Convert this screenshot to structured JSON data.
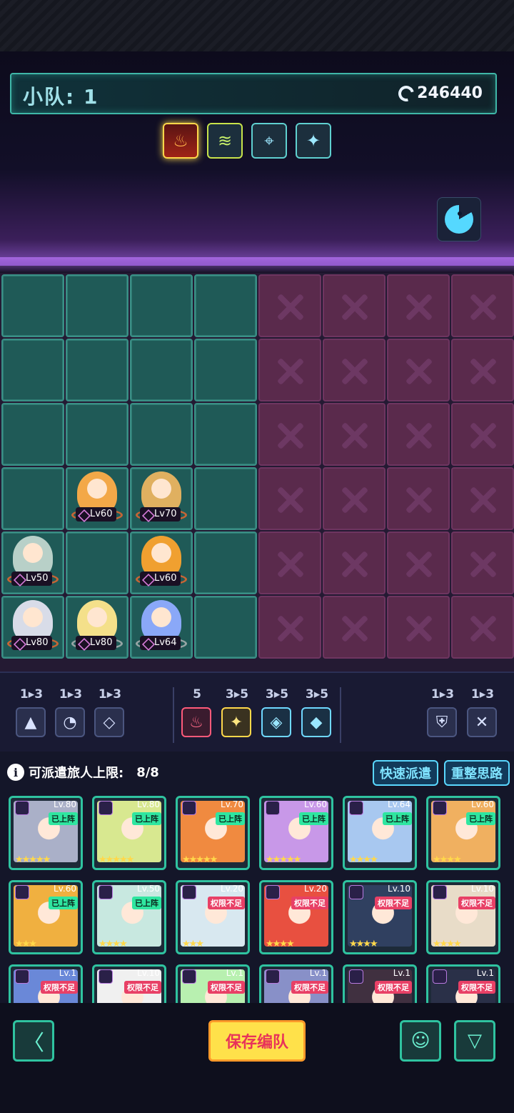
{
  "header": {
    "squad_label": "小队: 1",
    "power": "246440"
  },
  "bonds": [
    {
      "icon": "flame-icon",
      "glyph": "♨"
    },
    {
      "icon": "wave-icon",
      "glyph": "≋"
    },
    {
      "icon": "target-icon",
      "glyph": "⌖"
    },
    {
      "icon": "sparkle-wand-icon",
      "glyph": "✦"
    }
  ],
  "units": [
    {
      "lv": "Lv60"
    },
    {
      "lv": "Lv70"
    },
    {
      "lv": "Lv50"
    },
    {
      "lv": "Lv60"
    },
    {
      "lv": "Lv80"
    },
    {
      "lv": "Lv80"
    },
    {
      "lv": "Lv64"
    }
  ],
  "synergies": {
    "left": [
      {
        "count": "1▸3",
        "glyph": "▲"
      },
      {
        "count": "1▸3",
        "glyph": "◔"
      },
      {
        "count": "1▸3",
        "glyph": "◇"
      }
    ],
    "center": [
      {
        "count": "5",
        "glyph": "♨"
      },
      {
        "count": "3▸5",
        "glyph": "✦"
      },
      {
        "count": "3▸5",
        "glyph": "◈"
      },
      {
        "count": "3▸5",
        "glyph": "◆"
      }
    ],
    "right": [
      {
        "count": "1▸3",
        "glyph": "⛨"
      },
      {
        "count": "1▸3",
        "glyph": "✕"
      }
    ]
  },
  "roster": {
    "info_label": "可派遣旅人上限:",
    "info_count": "8/8",
    "quick_dispatch": "快速派遣",
    "rethink": "重整思路",
    "cards": [
      {
        "lv": "Lv.80",
        "status": "已上阵",
        "stars": "★★★★★"
      },
      {
        "lv": "Lv.80",
        "status": "已上阵",
        "stars": "★★★★★"
      },
      {
        "lv": "Lv.70",
        "status": "已上阵",
        "stars": "★★★★★"
      },
      {
        "lv": "Lv.60",
        "status": "已上阵",
        "stars": "★★★★★"
      },
      {
        "lv": "Lv.64",
        "status": "已上阵",
        "stars": "★★★★"
      },
      {
        "lv": "Lv.60",
        "status": "已上阵",
        "stars": "★★★★"
      },
      {
        "lv": "Lv.60",
        "status": "已上阵",
        "stars": "★★★"
      },
      {
        "lv": "Lv.50",
        "status": "已上阵",
        "stars": "★★★★"
      },
      {
        "lv": "Lv.20",
        "status": "权限不足",
        "stars": "★★★"
      },
      {
        "lv": "Lv.20",
        "status": "权限不足",
        "stars": "★★★★"
      },
      {
        "lv": "Lv.10",
        "status": "权限不足",
        "stars": "★★★★"
      },
      {
        "lv": "Lv.10",
        "status": "权限不足",
        "stars": "★★★★"
      },
      {
        "lv": "Lv.1",
        "status": "权限不足",
        "stars": ""
      },
      {
        "lv": "Lv.10",
        "status": "权限不足",
        "stars": ""
      },
      {
        "lv": "Lv.1",
        "status": "权限不足",
        "stars": ""
      },
      {
        "lv": "Lv.1",
        "status": "权限不足",
        "stars": ""
      },
      {
        "lv": "Lv.1",
        "status": "权限不足",
        "stars": ""
      },
      {
        "lv": "Lv.1",
        "status": "权限不足",
        "stars": ""
      }
    ]
  },
  "footer": {
    "save_label": "保存编队",
    "back_glyph": "〈",
    "brain_glyph": "☺",
    "filter_glyph": "▽"
  }
}
